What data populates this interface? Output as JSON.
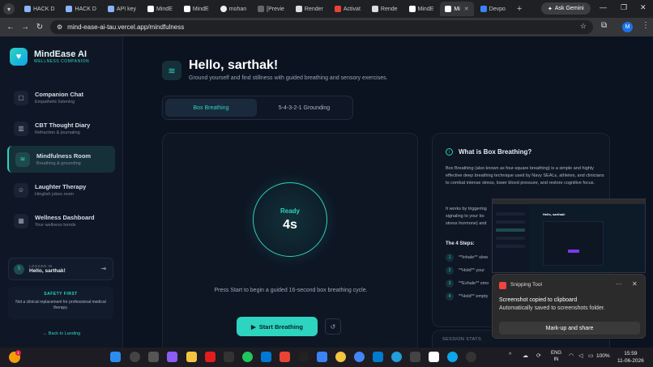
{
  "browser": {
    "tabs": [
      {
        "label": "HACK D",
        "active": false
      },
      {
        "label": "HACK D",
        "active": false
      },
      {
        "label": "API key",
        "active": false
      },
      {
        "label": "MindE",
        "active": false
      },
      {
        "label": "MindE",
        "active": false
      },
      {
        "label": "mohan",
        "active": false
      },
      {
        "label": "[Previe",
        "active": false
      },
      {
        "label": "Render",
        "active": false
      },
      {
        "label": "Activat",
        "active": false
      },
      {
        "label": "Rende",
        "active": false
      },
      {
        "label": "MindE",
        "active": false
      },
      {
        "label": "Mi",
        "active": true
      },
      {
        "label": "Devpo",
        "active": false
      }
    ],
    "ask_gemini": "Ask Gemini",
    "url": "mind-ease-ai-tau.vercel.app/mindfulness",
    "profile_initial": "M"
  },
  "sidebar": {
    "brand_name": "MindEase AI",
    "brand_sub": "WELLNESS COMPANION",
    "items": [
      {
        "title": "Companion Chat",
        "sub": "Empathetic listening"
      },
      {
        "title": "CBT Thought Diary",
        "sub": "Refraction & journaling"
      },
      {
        "title": "Mindfulness Room",
        "sub": "Breathing & grounding"
      },
      {
        "title": "Laughter Therapy",
        "sub": "Hinglish jokes room"
      },
      {
        "title": "Wellness Dashboard",
        "sub": "Your wellness trends"
      }
    ],
    "login_caption": "LOGGED IN",
    "login_name": "Hello, sarthak!",
    "avatar_initial": "S",
    "safety_title": "SAFETY FIRST",
    "safety_text": "Not a clinical replacement for professional medical therapy.",
    "back_link": "← Back to Landing"
  },
  "main": {
    "title": "Hello, sarthak!",
    "subtitle": "Ground yourself and find stillness with guided breathing and sensory exercises.",
    "tabs": [
      "Box Breathing",
      "5-4-3-2-1 Grounding"
    ],
    "ring_label": "Ready",
    "ring_count": "4s",
    "instruction": "Press Start to begin a guided 16-second box breathing cycle.",
    "start_button": "Start Breathing",
    "info_title": "What is Box Breathing?",
    "info_p1": "Box Breathing (also known as four-square breathing) is a simple and highly effective deep breathing technique used by Navy SEALs, athletes, and clinicians to combat intense stress, lower blood pressure, and restore cognitive focus.",
    "info_p2": "It works by triggering signaling to your bo stress hormone) and",
    "steps_title": "The 4 Steps:",
    "steps": [
      "**Inhale** slow",
      "**Hold** your",
      "**Exhale** smo",
      "**Hold** empty"
    ],
    "session_title": "SESSION STATS"
  },
  "thumbnail": {
    "title": "Hello, sarthak!"
  },
  "toast": {
    "app": "Snipping Tool",
    "title": "Screenshot copied to clipboard",
    "body": "Automatically saved to screenshots folder.",
    "action": "Mark-up and share"
  },
  "taskbar": {
    "weather_badge": "1",
    "lang_line1": "ENG",
    "lang_line2": "IN",
    "battery": "100%",
    "time": "15:59",
    "date": "11-06-2026"
  },
  "colors": {
    "accent": "#2dd4bf",
    "background": "#0b1220",
    "sidebar": "#0f1726"
  }
}
